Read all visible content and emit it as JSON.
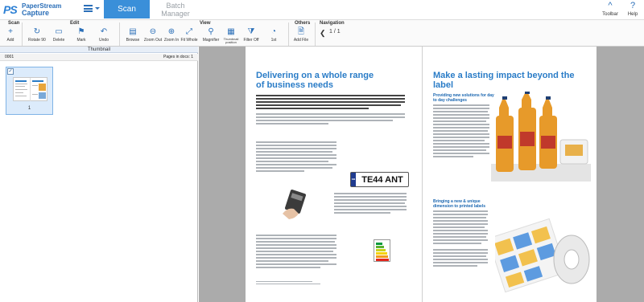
{
  "app": {
    "logo_line1": "PaperStream",
    "logo_line2": "Capture",
    "logo_mark": "PS"
  },
  "tabs": [
    {
      "label": "Scan",
      "active": true
    },
    {
      "label": "Batch Manager",
      "active": false
    }
  ],
  "top_right": {
    "toolbar_label": "Toolbar",
    "help_label": "Help"
  },
  "ribbon": {
    "groups": {
      "scan": "Scan",
      "edit": "Edit",
      "view": "View",
      "others": "Others",
      "navigation": "Navigation"
    },
    "buttons": {
      "add": "Add",
      "rotate": "Rotate 90",
      "delete": "Delete",
      "mark": "Mark",
      "undo": "Undo",
      "browse": "Browse",
      "zoom_out": "Zoom Out",
      "zoom_in": "Zoom In",
      "fit_whole": "Fit Whole",
      "magnifier": "Magnifier",
      "thumbnail_position": "Thumbnail position",
      "filter_off": "Filter Off",
      "first": "1st",
      "add_file": "Add File"
    },
    "navigation": {
      "page_current": "1",
      "page_total": "1",
      "page_text": "1 / 1"
    }
  },
  "thumbnail_panel": {
    "header": "Thumbnail",
    "batch_id": "0001",
    "pages_label": "Pages in docs: 1",
    "thumb_number": "1"
  },
  "document": {
    "left_title": "Delivering on a whole range of business needs",
    "right_title": "Make a lasting impact beyond the label",
    "right_sub1": "Providing new solutions for day to day challenges",
    "right_sub2": "Bringing a new & unique dimension to printed labels",
    "plate_text": "TE44 ANT",
    "plate_region": "GB"
  },
  "icons": {
    "add": "add-icon",
    "rotate": "rotate-icon",
    "delete": "trash-icon",
    "mark": "flag-icon",
    "undo": "undo-icon",
    "browse": "browse-icon",
    "zoom_out": "zoom-out-icon",
    "zoom_in": "zoom-in-icon",
    "fit_whole": "fit-whole-icon",
    "magnifier": "magnifier-icon",
    "thumbnail_position": "thumbnail-position-icon",
    "filter_off": "filter-icon",
    "first": "first-page-icon",
    "add_file": "add-file-icon",
    "toolbar": "toolbar-icon",
    "help": "help-icon"
  },
  "colors": {
    "accent": "#3a8fd9",
    "brand": "#2b6fb8",
    "title_blue": "#2a7cc7",
    "viewer_bg": "#ababab"
  }
}
